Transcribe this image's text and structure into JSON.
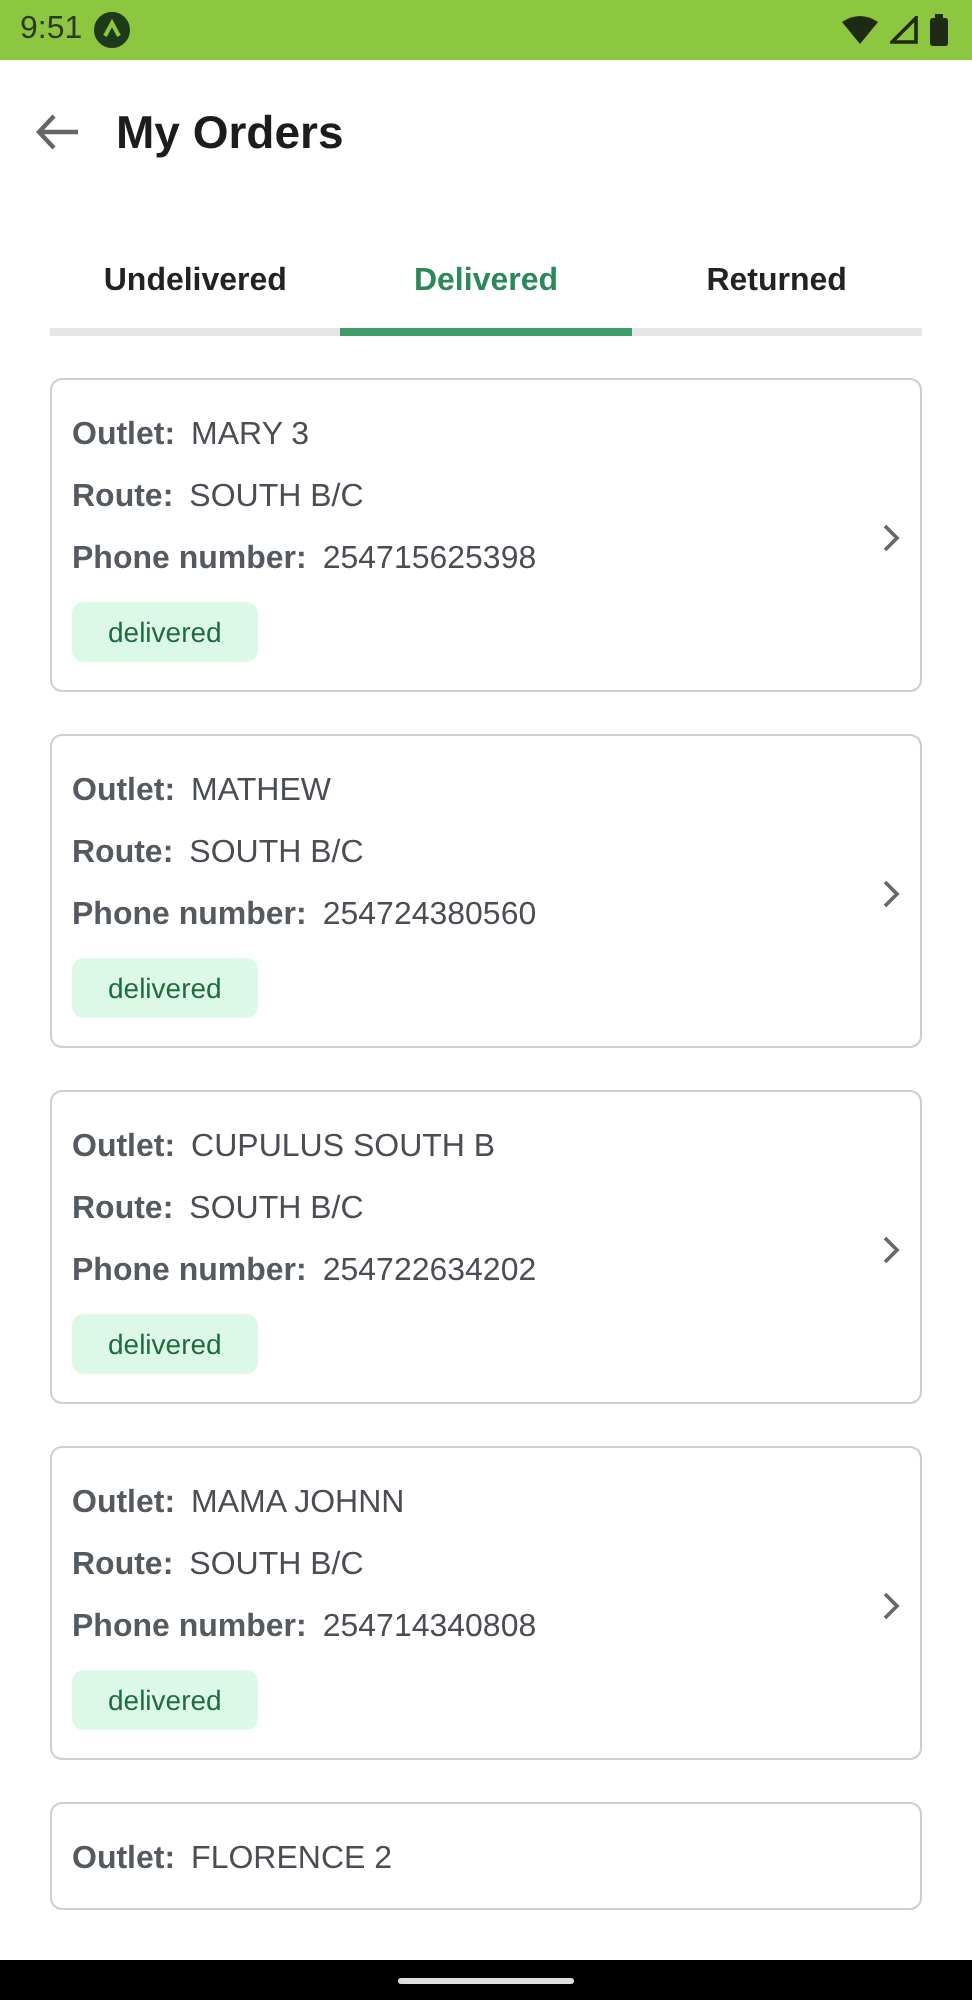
{
  "status_bar": {
    "time": "9:51"
  },
  "header": {
    "title": "My Orders"
  },
  "tabs": [
    {
      "label": "Undelivered",
      "selected": false
    },
    {
      "label": "Delivered",
      "selected": true
    },
    {
      "label": "Returned",
      "selected": false
    }
  ],
  "orders": [
    {
      "fields": [
        {
          "label": "Outlet:",
          "value": "MARY 3"
        },
        {
          "label": "Route:",
          "value": "SOUTH B/C"
        },
        {
          "label": "Phone number:",
          "value": "254715625398"
        }
      ],
      "status": "delivered"
    },
    {
      "fields": [
        {
          "label": "Outlet:",
          "value": "MATHEW"
        },
        {
          "label": "Route:",
          "value": "SOUTH B/C"
        },
        {
          "label": "Phone number:",
          "value": "254724380560"
        }
      ],
      "status": "delivered"
    },
    {
      "fields": [
        {
          "label": "Outlet:",
          "value": "CUPULUS SOUTH B"
        },
        {
          "label": "Route:",
          "value": "SOUTH B/C"
        },
        {
          "label": "Phone number:",
          "value": "254722634202"
        }
      ],
      "status": "delivered"
    },
    {
      "fields": [
        {
          "label": "Outlet:",
          "value": "MAMA JOHNN"
        },
        {
          "label": "Route:",
          "value": "SOUTH B/C"
        },
        {
          "label": "Phone number:",
          "value": "254714340808"
        }
      ],
      "status": "delivered"
    },
    {
      "fields": [
        {
          "label": "Outlet:",
          "value": "FLORENCE 2"
        }
      ]
    }
  ]
}
